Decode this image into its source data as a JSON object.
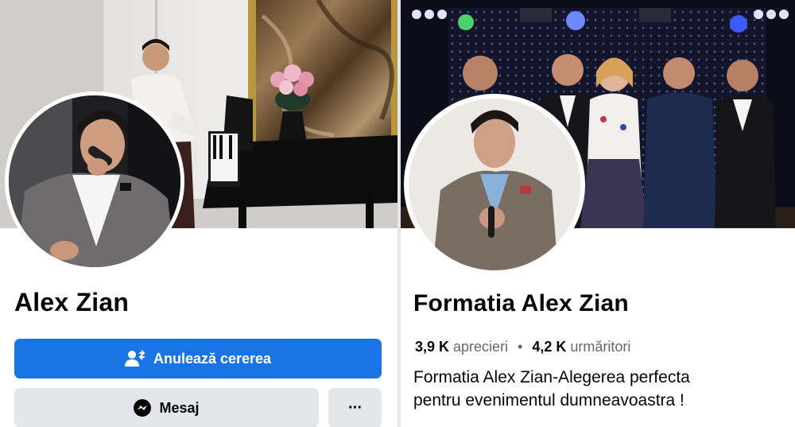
{
  "left_profile": {
    "name": "Alex Zian",
    "primary_button_label": "Anulează cererea",
    "message_button_label": "Mesaj",
    "more_button_label": "···"
  },
  "right_profile": {
    "name": "Formatia Alex Zian",
    "likes_count": "3,9 K",
    "likes_label": "aprecieri",
    "separator": "•",
    "followers_count": "4,2 K",
    "followers_label": "urmăritori",
    "description_line1": "Formatia Alex Zian-Alegerea perfecta",
    "description_line2": "pentru evenimentul dumneavoastra !"
  },
  "colors": {
    "primary": "#1b74e4",
    "secondary": "#e4e6eb",
    "text": "#050505",
    "muted": "#65676b"
  },
  "icons": {
    "primary_button": "person-cancel-request-icon",
    "message_button": "messenger-icon",
    "more_button": "more-dots-icon"
  }
}
